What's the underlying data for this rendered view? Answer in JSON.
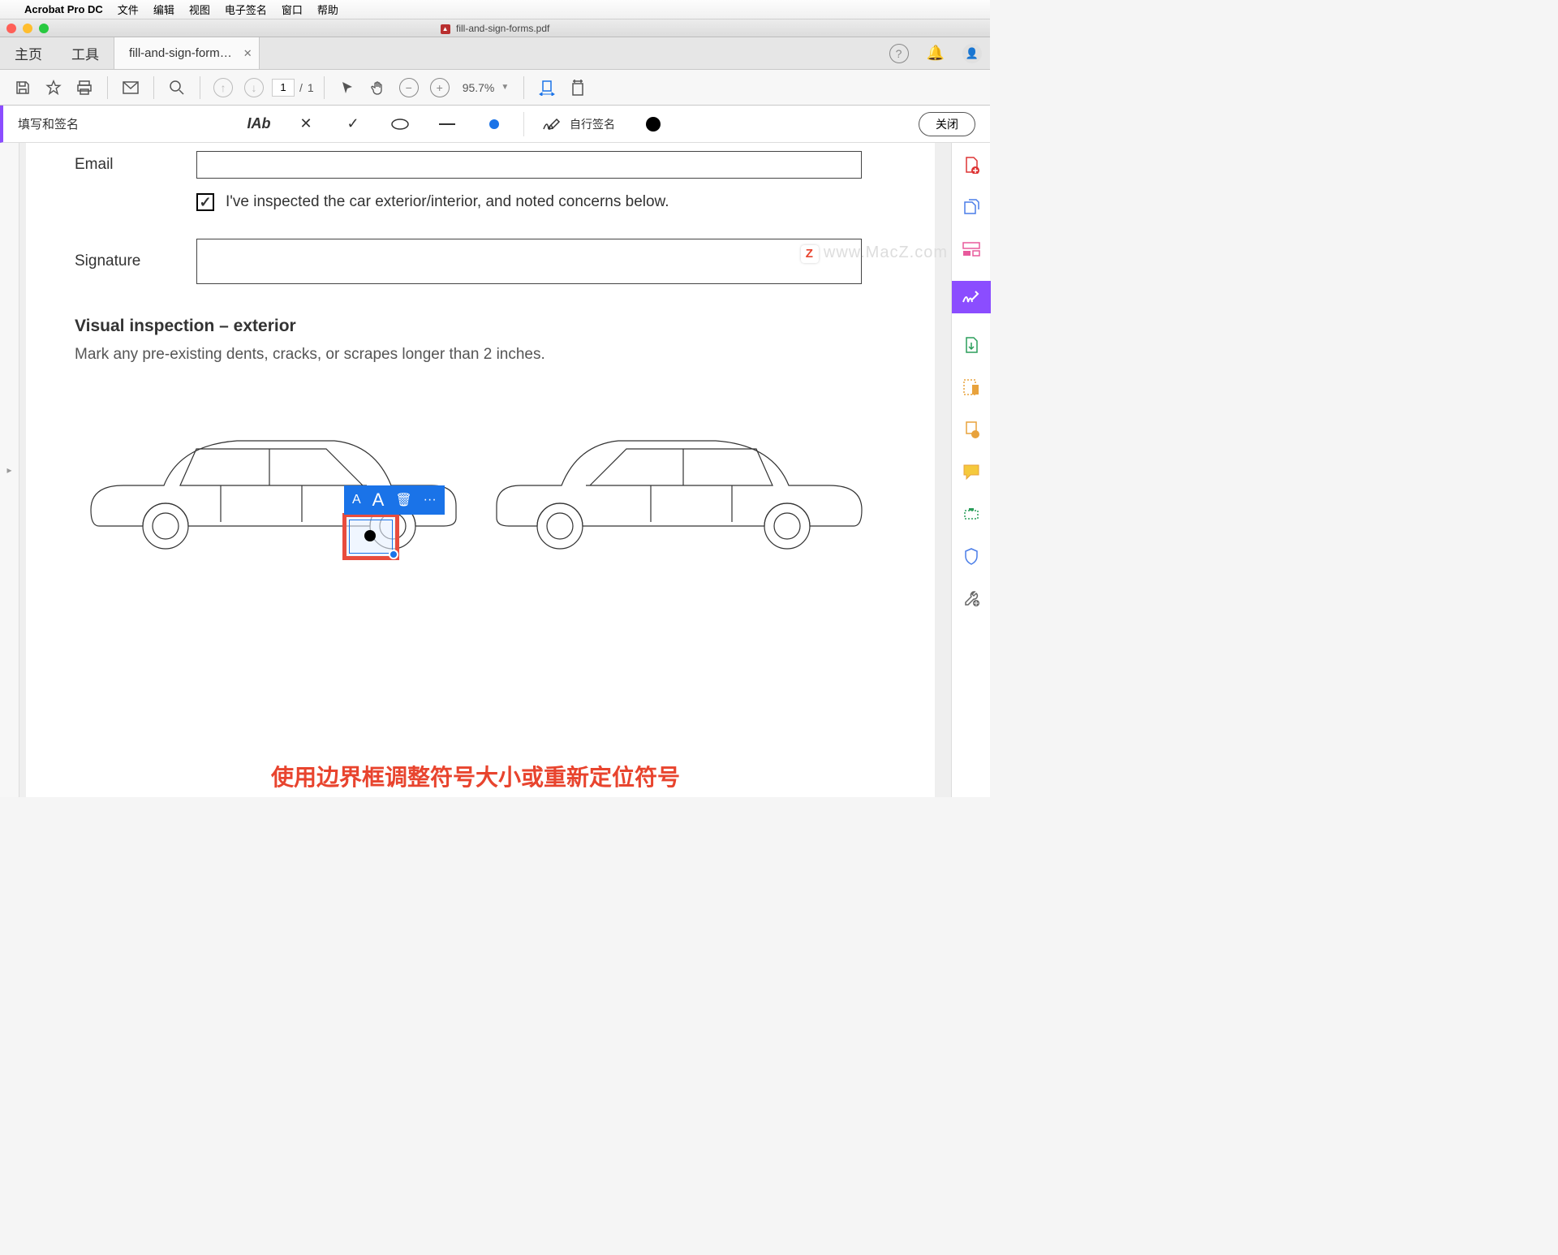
{
  "menubar": {
    "app": "Acrobat Pro DC",
    "items": [
      "文件",
      "编辑",
      "视图",
      "电子签名",
      "窗口",
      "帮助"
    ]
  },
  "window": {
    "title": "fill-and-sign-forms.pdf"
  },
  "tabs": {
    "home": "主页",
    "tools": "工具",
    "doc": "fill-and-sign-form…"
  },
  "toolbar": {
    "page_current": "1",
    "page_total": "1",
    "zoom": "95.7%"
  },
  "fillsign": {
    "title": "填写和签名",
    "textTool": "IAb",
    "selfSign": "自行签名",
    "close": "关闭"
  },
  "form": {
    "email_label": "Email",
    "inspect_text": "I've inspected the car exterior/interior, and noted concerns below.",
    "signature_label": "Signature",
    "section_title": "Visual inspection – exterior",
    "section_sub": "Mark any pre-existing dents, cracks, or scrapes longer than 2 inches."
  },
  "annot": {
    "smallA": "A",
    "bigA": "A",
    "more": "···"
  },
  "caption": "使用边界框调整符号大小或重新定位符号",
  "watermark": "www.MacZ.com"
}
